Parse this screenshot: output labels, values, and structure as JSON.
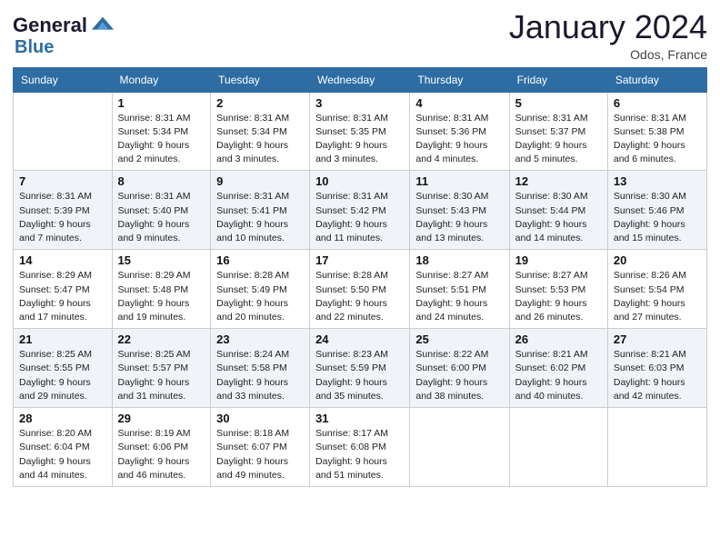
{
  "header": {
    "logo_line1": "General",
    "logo_line2": "Blue",
    "month": "January 2024",
    "location": "Odos, France"
  },
  "days_of_week": [
    "Sunday",
    "Monday",
    "Tuesday",
    "Wednesday",
    "Thursday",
    "Friday",
    "Saturday"
  ],
  "weeks": [
    [
      {
        "num": "",
        "sunrise": "",
        "sunset": "",
        "daylight": ""
      },
      {
        "num": "1",
        "sunrise": "Sunrise: 8:31 AM",
        "sunset": "Sunset: 5:34 PM",
        "daylight": "Daylight: 9 hours and 2 minutes."
      },
      {
        "num": "2",
        "sunrise": "Sunrise: 8:31 AM",
        "sunset": "Sunset: 5:34 PM",
        "daylight": "Daylight: 9 hours and 3 minutes."
      },
      {
        "num": "3",
        "sunrise": "Sunrise: 8:31 AM",
        "sunset": "Sunset: 5:35 PM",
        "daylight": "Daylight: 9 hours and 3 minutes."
      },
      {
        "num": "4",
        "sunrise": "Sunrise: 8:31 AM",
        "sunset": "Sunset: 5:36 PM",
        "daylight": "Daylight: 9 hours and 4 minutes."
      },
      {
        "num": "5",
        "sunrise": "Sunrise: 8:31 AM",
        "sunset": "Sunset: 5:37 PM",
        "daylight": "Daylight: 9 hours and 5 minutes."
      },
      {
        "num": "6",
        "sunrise": "Sunrise: 8:31 AM",
        "sunset": "Sunset: 5:38 PM",
        "daylight": "Daylight: 9 hours and 6 minutes."
      }
    ],
    [
      {
        "num": "7",
        "sunrise": "Sunrise: 8:31 AM",
        "sunset": "Sunset: 5:39 PM",
        "daylight": "Daylight: 9 hours and 7 minutes."
      },
      {
        "num": "8",
        "sunrise": "Sunrise: 8:31 AM",
        "sunset": "Sunset: 5:40 PM",
        "daylight": "Daylight: 9 hours and 9 minutes."
      },
      {
        "num": "9",
        "sunrise": "Sunrise: 8:31 AM",
        "sunset": "Sunset: 5:41 PM",
        "daylight": "Daylight: 9 hours and 10 minutes."
      },
      {
        "num": "10",
        "sunrise": "Sunrise: 8:31 AM",
        "sunset": "Sunset: 5:42 PM",
        "daylight": "Daylight: 9 hours and 11 minutes."
      },
      {
        "num": "11",
        "sunrise": "Sunrise: 8:30 AM",
        "sunset": "Sunset: 5:43 PM",
        "daylight": "Daylight: 9 hours and 13 minutes."
      },
      {
        "num": "12",
        "sunrise": "Sunrise: 8:30 AM",
        "sunset": "Sunset: 5:44 PM",
        "daylight": "Daylight: 9 hours and 14 minutes."
      },
      {
        "num": "13",
        "sunrise": "Sunrise: 8:30 AM",
        "sunset": "Sunset: 5:46 PM",
        "daylight": "Daylight: 9 hours and 15 minutes."
      }
    ],
    [
      {
        "num": "14",
        "sunrise": "Sunrise: 8:29 AM",
        "sunset": "Sunset: 5:47 PM",
        "daylight": "Daylight: 9 hours and 17 minutes."
      },
      {
        "num": "15",
        "sunrise": "Sunrise: 8:29 AM",
        "sunset": "Sunset: 5:48 PM",
        "daylight": "Daylight: 9 hours and 19 minutes."
      },
      {
        "num": "16",
        "sunrise": "Sunrise: 8:28 AM",
        "sunset": "Sunset: 5:49 PM",
        "daylight": "Daylight: 9 hours and 20 minutes."
      },
      {
        "num": "17",
        "sunrise": "Sunrise: 8:28 AM",
        "sunset": "Sunset: 5:50 PM",
        "daylight": "Daylight: 9 hours and 22 minutes."
      },
      {
        "num": "18",
        "sunrise": "Sunrise: 8:27 AM",
        "sunset": "Sunset: 5:51 PM",
        "daylight": "Daylight: 9 hours and 24 minutes."
      },
      {
        "num": "19",
        "sunrise": "Sunrise: 8:27 AM",
        "sunset": "Sunset: 5:53 PM",
        "daylight": "Daylight: 9 hours and 26 minutes."
      },
      {
        "num": "20",
        "sunrise": "Sunrise: 8:26 AM",
        "sunset": "Sunset: 5:54 PM",
        "daylight": "Daylight: 9 hours and 27 minutes."
      }
    ],
    [
      {
        "num": "21",
        "sunrise": "Sunrise: 8:25 AM",
        "sunset": "Sunset: 5:55 PM",
        "daylight": "Daylight: 9 hours and 29 minutes."
      },
      {
        "num": "22",
        "sunrise": "Sunrise: 8:25 AM",
        "sunset": "Sunset: 5:57 PM",
        "daylight": "Daylight: 9 hours and 31 minutes."
      },
      {
        "num": "23",
        "sunrise": "Sunrise: 8:24 AM",
        "sunset": "Sunset: 5:58 PM",
        "daylight": "Daylight: 9 hours and 33 minutes."
      },
      {
        "num": "24",
        "sunrise": "Sunrise: 8:23 AM",
        "sunset": "Sunset: 5:59 PM",
        "daylight": "Daylight: 9 hours and 35 minutes."
      },
      {
        "num": "25",
        "sunrise": "Sunrise: 8:22 AM",
        "sunset": "Sunset: 6:00 PM",
        "daylight": "Daylight: 9 hours and 38 minutes."
      },
      {
        "num": "26",
        "sunrise": "Sunrise: 8:21 AM",
        "sunset": "Sunset: 6:02 PM",
        "daylight": "Daylight: 9 hours and 40 minutes."
      },
      {
        "num": "27",
        "sunrise": "Sunrise: 8:21 AM",
        "sunset": "Sunset: 6:03 PM",
        "daylight": "Daylight: 9 hours and 42 minutes."
      }
    ],
    [
      {
        "num": "28",
        "sunrise": "Sunrise: 8:20 AM",
        "sunset": "Sunset: 6:04 PM",
        "daylight": "Daylight: 9 hours and 44 minutes."
      },
      {
        "num": "29",
        "sunrise": "Sunrise: 8:19 AM",
        "sunset": "Sunset: 6:06 PM",
        "daylight": "Daylight: 9 hours and 46 minutes."
      },
      {
        "num": "30",
        "sunrise": "Sunrise: 8:18 AM",
        "sunset": "Sunset: 6:07 PM",
        "daylight": "Daylight: 9 hours and 49 minutes."
      },
      {
        "num": "31",
        "sunrise": "Sunrise: 8:17 AM",
        "sunset": "Sunset: 6:08 PM",
        "daylight": "Daylight: 9 hours and 51 minutes."
      },
      {
        "num": "",
        "sunrise": "",
        "sunset": "",
        "daylight": ""
      },
      {
        "num": "",
        "sunrise": "",
        "sunset": "",
        "daylight": ""
      },
      {
        "num": "",
        "sunrise": "",
        "sunset": "",
        "daylight": ""
      }
    ]
  ]
}
